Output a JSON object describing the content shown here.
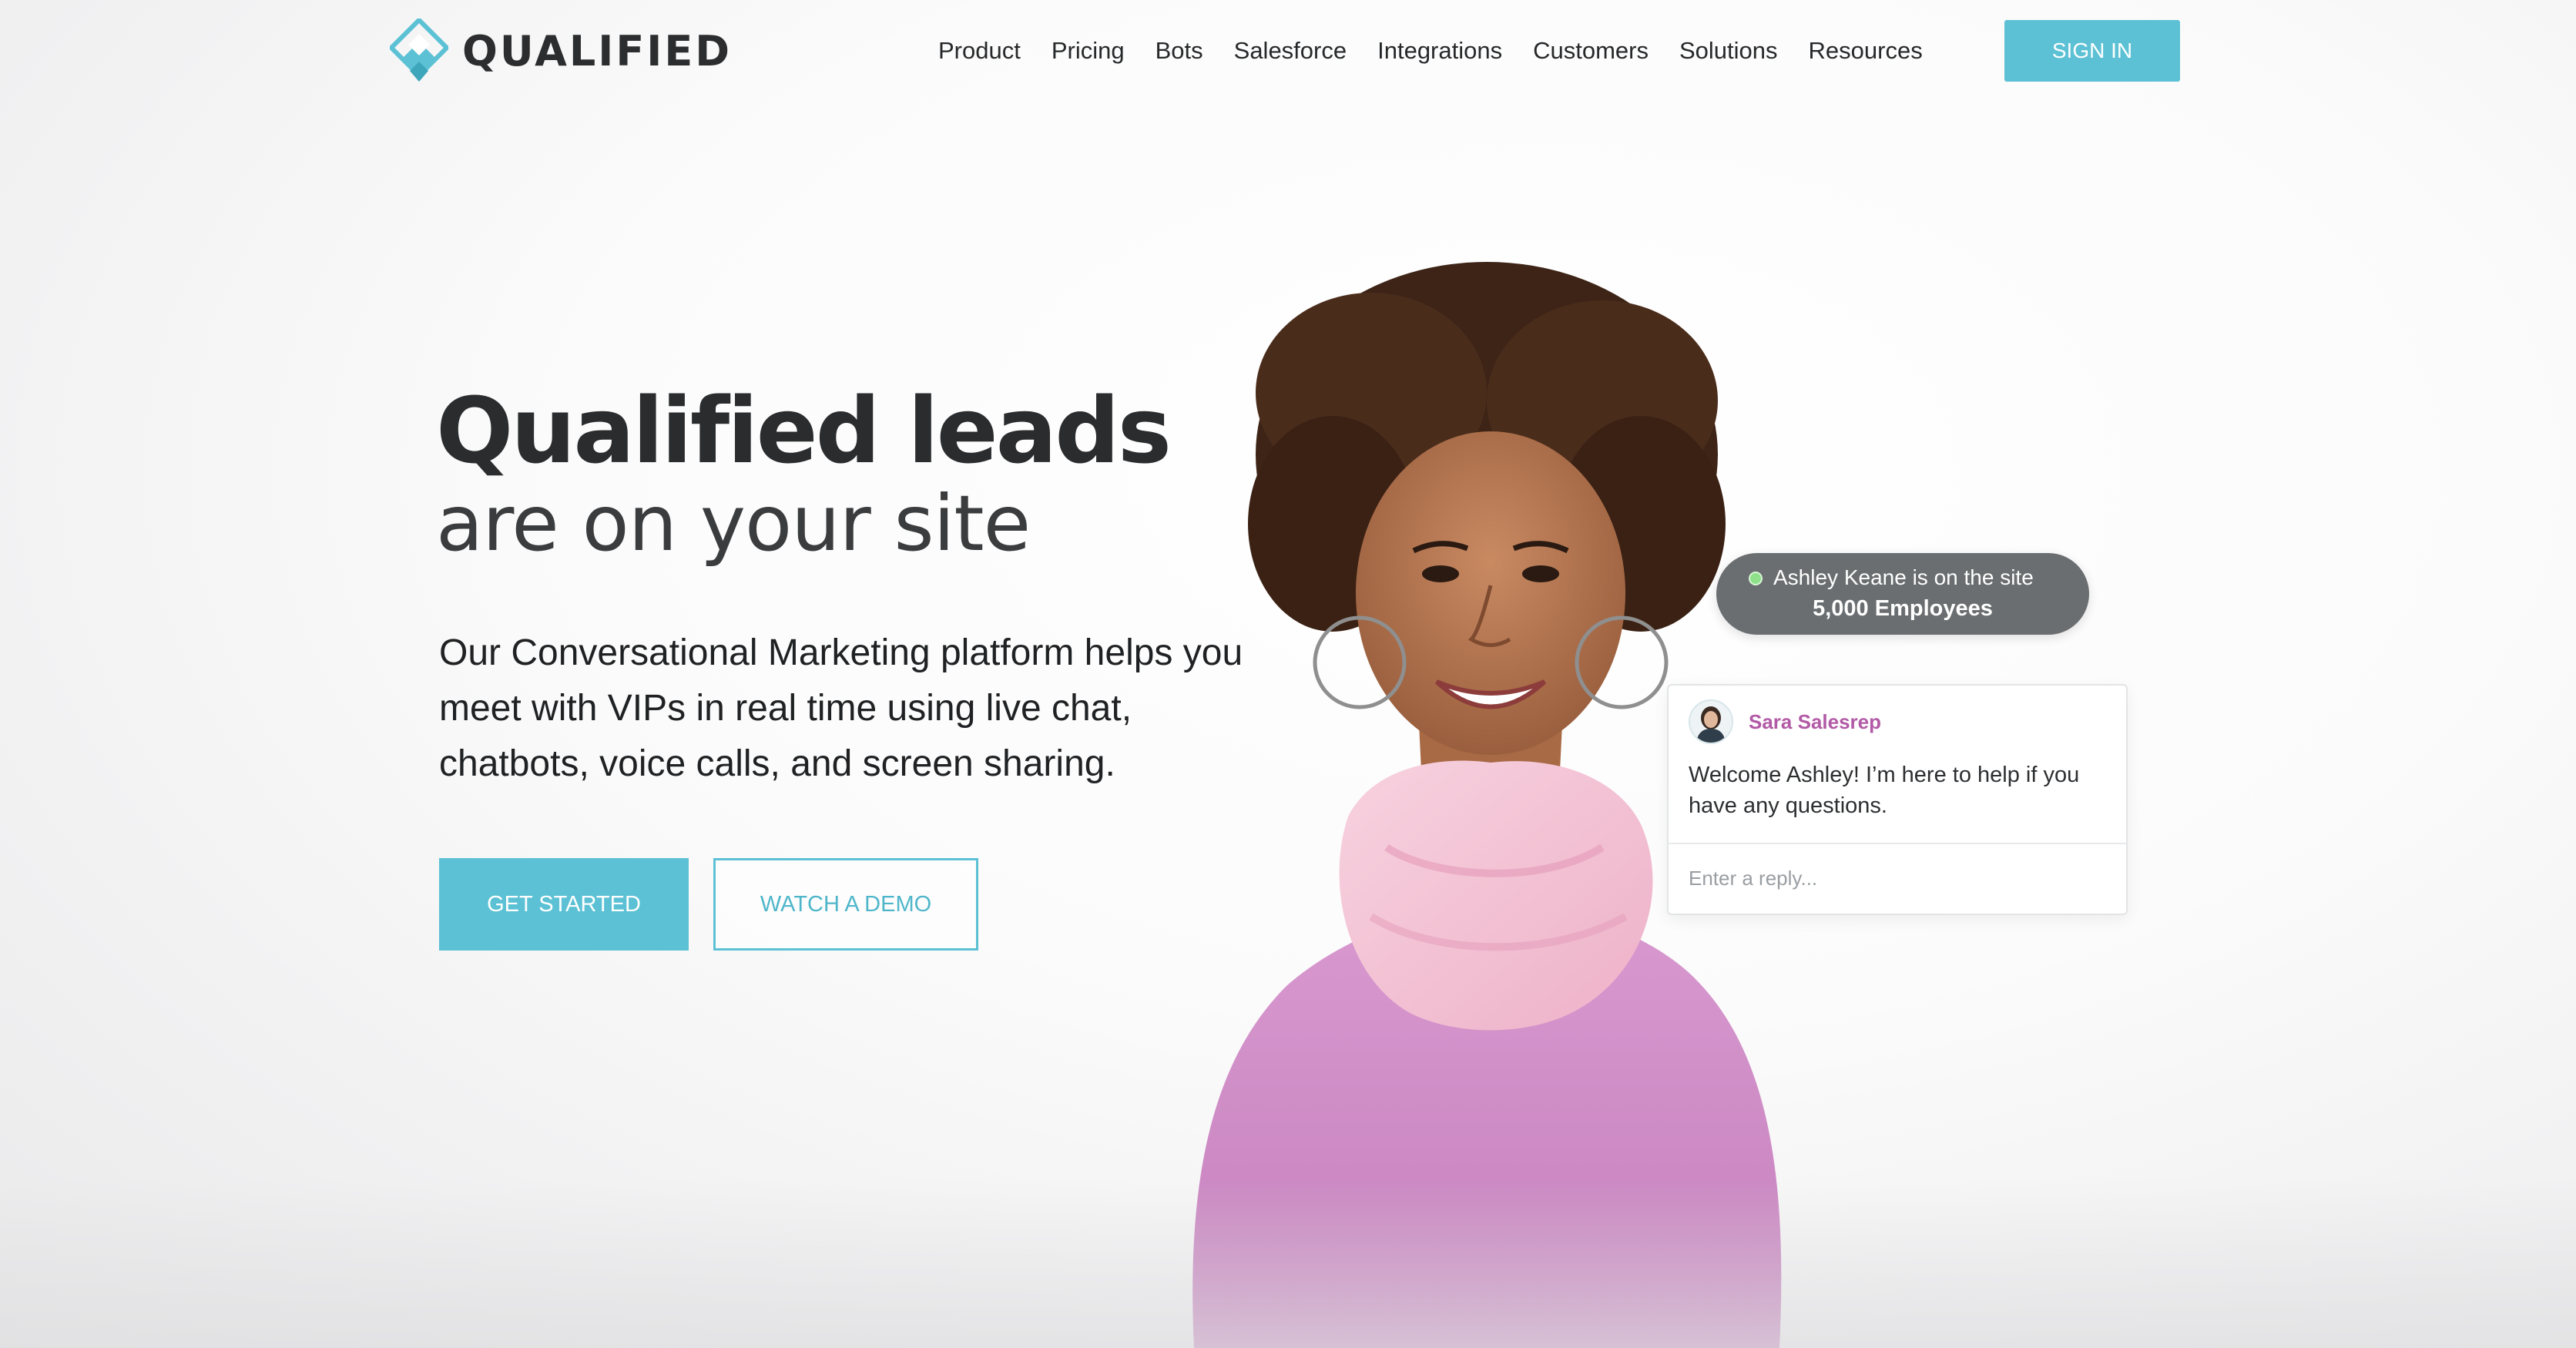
{
  "header": {
    "logo_text": "QUALIFIED",
    "nav": [
      {
        "label": "Product"
      },
      {
        "label": "Pricing"
      },
      {
        "label": "Bots"
      },
      {
        "label": "Salesforce"
      },
      {
        "label": "Integrations"
      },
      {
        "label": "Customers"
      },
      {
        "label": "Solutions"
      },
      {
        "label": "Resources"
      }
    ],
    "sign_in_label": "SIGN IN"
  },
  "hero": {
    "title": "Qualified leads",
    "subtitle": "are on your site",
    "description": "Our Conversational Marketing platform helps you meet with VIPs in real time using live chat, chatbots, voice calls, and screen sharing.",
    "primary_cta": "GET STARTED",
    "secondary_cta": "WATCH A DEMO"
  },
  "visitor_notice": {
    "line1": "Ashley Keane is on the site",
    "line2": "5,000 Employees"
  },
  "chat": {
    "agent_name": "Sara Salesrep",
    "message": "Welcome Ashley! I’m here to help if you have any questions.",
    "input_placeholder": "Enter a reply..."
  },
  "colors": {
    "accent": "#5cc1d4",
    "agent_name": "#b25aa6",
    "pill_background": "#6a6e70",
    "online_status": "#8ee08a",
    "sweater": "#d48cc8",
    "scarf": "#f4c3d6"
  },
  "icons": {
    "logo": "qualified-diamond-logo",
    "status": "online-dot",
    "avatar": "agent-avatar"
  }
}
